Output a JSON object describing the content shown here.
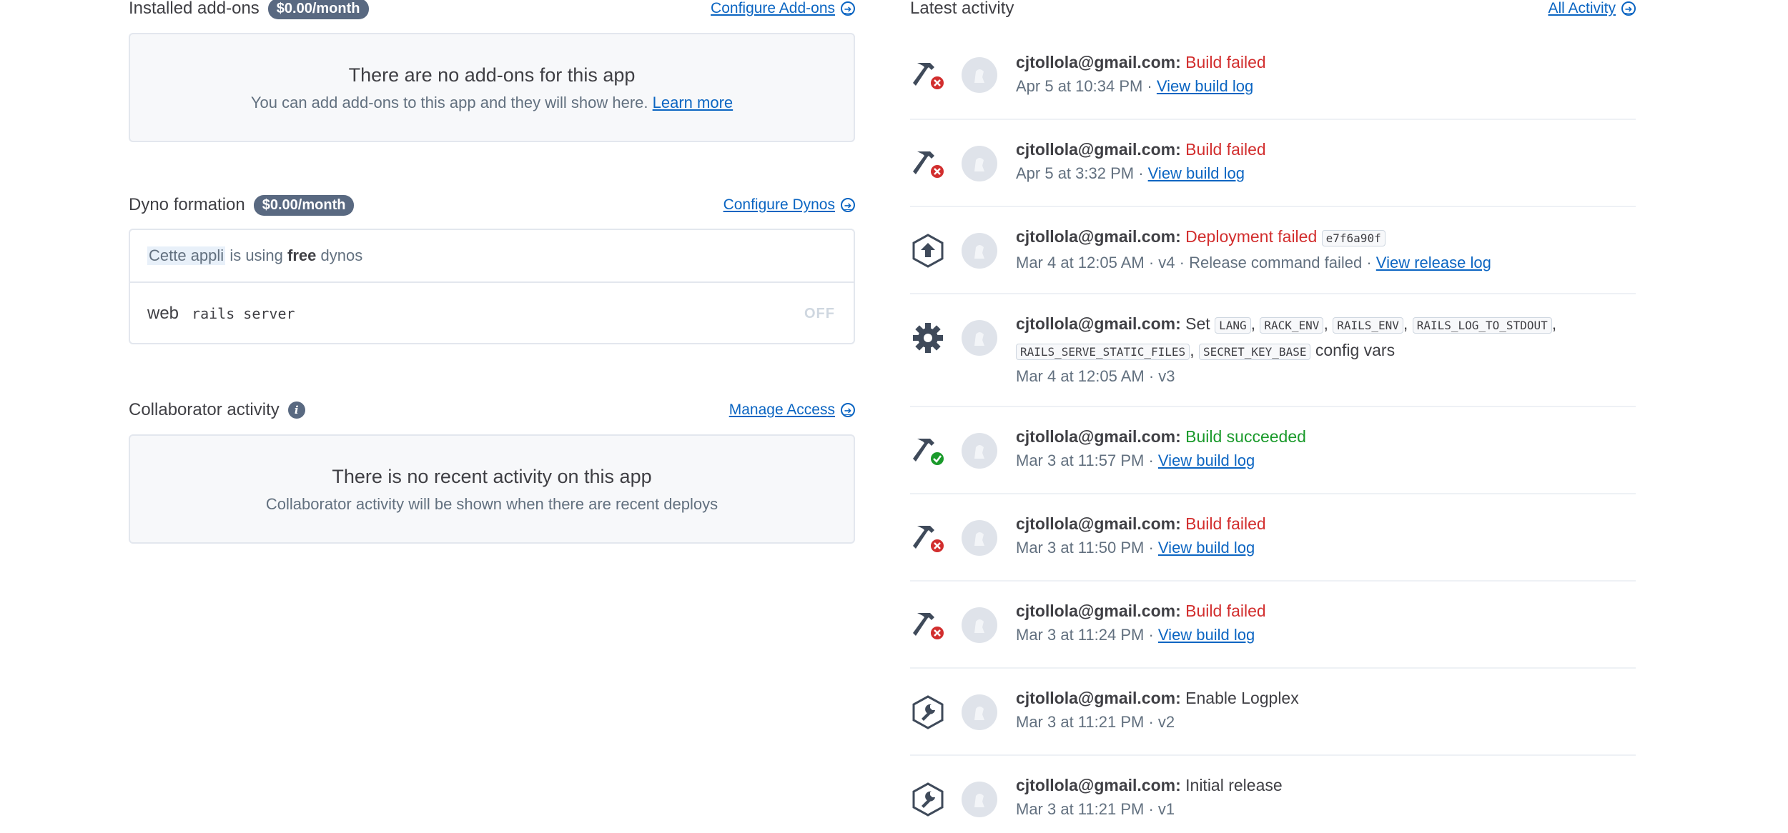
{
  "addons": {
    "title": "Installed add-ons",
    "badge": "$0.00/month",
    "link": "Configure Add-ons",
    "empty_title": "There are no add-ons for this app",
    "empty_sub": "You can add add-ons to this app and they will show here.",
    "learn_more": "Learn more"
  },
  "dynos": {
    "title": "Dyno formation",
    "badge": "$0.00/month",
    "link": "Configure Dynos",
    "app_word": "Cette appli",
    "using_text": "is using",
    "free_word": "free",
    "dynos_word": "dynos",
    "web_label": "web",
    "command": "rails server",
    "state": "OFF"
  },
  "collab": {
    "title": "Collaborator activity",
    "link": "Manage Access",
    "empty_title": "There is no recent activity on this app",
    "empty_sub": "Collaborator activity will be shown when there are recent deploys"
  },
  "activity": {
    "title": "Latest activity",
    "link": "All Activity",
    "items": [
      {
        "icon": "build-failed-icon",
        "email": "cjtollola@gmail.com:",
        "status": "Build failed",
        "time": "Apr 5 at 10:34 PM ·",
        "link": "View build log"
      },
      {
        "icon": "build-failed-icon",
        "email": "cjtollola@gmail.com:",
        "status": "Build failed",
        "time": "Apr 5 at 3:32 PM ·",
        "link": "View build log"
      },
      {
        "icon": "deploy-icon",
        "email": "cjtollola@gmail.com:",
        "status": "Deployment failed",
        "commit": "e7f6a90f",
        "time": "Mar 4 at 12:05 AM · v4 · Release command failed ·",
        "link": "View release log"
      },
      {
        "icon": "gear-icon",
        "email": "cjtollola@gmail.com:",
        "set_word": "Set",
        "vars": [
          "LANG",
          "RACK_ENV",
          "RAILS_ENV",
          "RAILS_LOG_TO_STDOUT",
          "RAILS_SERVE_STATIC_FILES",
          "SECRET_KEY_BASE"
        ],
        "suffix": "config vars",
        "time": "Mar 4 at 12:05 AM · v3"
      },
      {
        "icon": "build-succeeded-icon",
        "email": "cjtollola@gmail.com:",
        "status": "Build succeeded",
        "time": "Mar 3 at 11:57 PM ·",
        "link": "View build log"
      },
      {
        "icon": "build-failed-icon",
        "email": "cjtollola@gmail.com:",
        "status": "Build failed",
        "time": "Mar 3 at 11:50 PM ·",
        "link": "View build log"
      },
      {
        "icon": "build-failed-icon",
        "email": "cjtollola@gmail.com:",
        "status": "Build failed",
        "time": "Mar 3 at 11:24 PM ·",
        "link": "View build log"
      },
      {
        "icon": "wrench-icon",
        "email": "cjtollola@gmail.com:",
        "text": "Enable Logplex",
        "time": "Mar 3 at 11:21 PM · v2"
      },
      {
        "icon": "wrench-icon",
        "email": "cjtollola@gmail.com:",
        "text": "Initial release",
        "time": "Mar 3 at 11:21 PM · v1"
      }
    ]
  }
}
